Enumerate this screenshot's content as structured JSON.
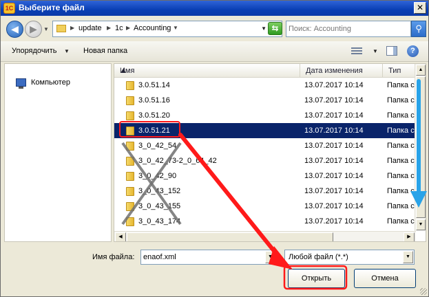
{
  "window": {
    "title": "Выберите файл",
    "app_badge": "1С",
    "close_glyph": "✕"
  },
  "address": {
    "crumbs": [
      "update",
      "1c",
      "Accounting"
    ],
    "search_placeholder": "Поиск: Accounting"
  },
  "toolbar": {
    "organize_label": "Упорядочить",
    "new_folder_label": "Новая папка",
    "help_glyph": "?"
  },
  "navigation": {
    "items": [
      {
        "label": "Компьютер",
        "icon": "computer-icon"
      }
    ]
  },
  "file_list": {
    "columns": {
      "name": "Имя",
      "date": "Дата изменения",
      "type": "Тип"
    },
    "rows": [
      {
        "name": "3.0.51.14",
        "date": "13.07.2017 10:14",
        "type": "Папка с ф",
        "selected": false
      },
      {
        "name": "3.0.51.16",
        "date": "13.07.2017 10:14",
        "type": "Папка с ф",
        "selected": false
      },
      {
        "name": "3.0.51.20",
        "date": "13.07.2017 10:14",
        "type": "Папка с ф",
        "selected": false
      },
      {
        "name": "3.0.51.21",
        "date": "13.07.2017 10:14",
        "type": "Папка с ф",
        "selected": true
      },
      {
        "name": "3_0_42_54",
        "date": "13.07.2017 10:14",
        "type": "Папка с ф",
        "selected": false
      },
      {
        "name": "3_0_42_73-2_0_64_42",
        "date": "13.07.2017 10:14",
        "type": "Папка с ф",
        "selected": false
      },
      {
        "name": "3_0_42_90",
        "date": "13.07.2017 10:14",
        "type": "Папка с ф",
        "selected": false
      },
      {
        "name": "3_0_43_152",
        "date": "13.07.2017 10:14",
        "type": "Папка с ф",
        "selected": false
      },
      {
        "name": "3_0_43_155",
        "date": "13.07.2017 10:14",
        "type": "Папка с ф",
        "selected": false
      },
      {
        "name": "3_0_43_174",
        "date": "13.07.2017 10:14",
        "type": "Папка с ф",
        "selected": false
      }
    ]
  },
  "bottom": {
    "filename_label": "Имя файла:",
    "filename_value": "enaof.xml",
    "filetype_value": "Любой файл (*.*)",
    "open_label": "Открыть",
    "cancel_label": "Отмена"
  },
  "colors": {
    "selection": "#0a246a",
    "annotation_red": "#ff1a1a",
    "annotation_blue": "#29a3e8",
    "cross_gray": "#707070"
  }
}
